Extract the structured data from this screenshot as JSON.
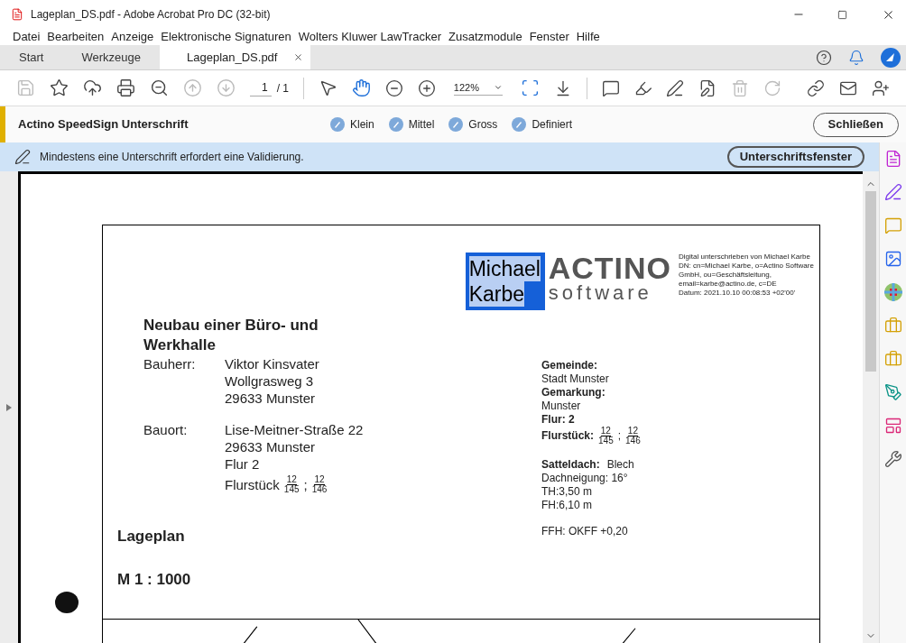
{
  "window": {
    "title": "Lageplan_DS.pdf - Adobe Acrobat Pro DC (32-bit)"
  },
  "menu": [
    "Datei",
    "Bearbeiten",
    "Anzeige",
    "Elektronische Signaturen",
    "Wolters Kluwer LawTracker",
    "Zusatzmodule",
    "Fenster",
    "Hilfe"
  ],
  "tabs": [
    {
      "label": "Start",
      "selected": false,
      "closable": false
    },
    {
      "label": "Werkzeuge",
      "selected": false,
      "closable": false
    },
    {
      "label": "Lageplan_DS.pdf",
      "selected": true,
      "closable": true
    }
  ],
  "toolbar": {
    "file_buttons": [
      {
        "disabled": true
      },
      {
        "disabled": false
      },
      {
        "disabled": false
      },
      {
        "disabled": false
      },
      {
        "disabled": false
      },
      {
        "disabled": true
      },
      {
        "disabled": true
      }
    ],
    "page": {
      "value": "1",
      "total": "/ 1"
    },
    "select_tools": [
      {
        "selected": false
      },
      {
        "selected": true
      }
    ],
    "zoom": "122%",
    "edit_buttons": [
      {
        "disabled": false
      },
      {
        "disabled": false
      },
      {
        "disabled": false
      },
      {
        "disabled": false
      },
      {
        "disabled": true
      },
      {
        "disabled": true
      },
      {
        "disabled": false
      },
      {
        "disabled": false
      },
      {
        "disabled": false
      }
    ]
  },
  "speedsign": {
    "title": "Actino SpeedSign Unterschrift",
    "sizes": [
      "Klein",
      "Mittel",
      "Gross",
      "Definiert"
    ],
    "close": "Schließen"
  },
  "notice": {
    "text": "Mindestens eine Unterschrift erfordert eine Validierung.",
    "button": "Unterschriftsfenster"
  },
  "document": {
    "signature": {
      "name": [
        "Michael",
        "Karbe"
      ],
      "logo": [
        "ACTINO",
        "software"
      ],
      "details": [
        "Digital unterschrieben von Michael Karbe",
        "DN: cn=Michael Karbe, o=Actino Software GmbH, ou=Geschäftsleitung, email=karbe@actino.de, c=DE",
        "Datum: 2021.10.10 00:08:53 +02'00'"
      ]
    },
    "heading": [
      "Neubau einer Büro- und",
      "Werkhalle"
    ],
    "parties": [
      {
        "label": "Bauherr:",
        "lines": [
          "Viktor Kinsvater",
          "Wollgrasweg 3",
          "29633 Munster"
        ]
      },
      {
        "label": "Bauort:",
        "lines": [
          "Lise-Meitner-Straße 22",
          "29633 Munster",
          "Flur 2"
        ],
        "parcel": {
          "label": "Flurstück",
          "fractions": [
            {
              "num": "12",
              "den": "145"
            },
            {
              "num": "12",
              "den": "146"
            }
          ],
          "separator": ";"
        }
      }
    ],
    "plan_title": "Lageplan",
    "scale": "M 1 : 1000",
    "details_groups": [
      [
        {
          "kind": "label",
          "text": "Gemeinde:"
        },
        {
          "kind": "text",
          "text": "Stadt Munster"
        },
        {
          "kind": "label",
          "text": "Gemarkung:"
        },
        {
          "kind": "text",
          "text": "Munster"
        },
        {
          "kind": "label",
          "text": "Flur: 2"
        },
        {
          "kind": "parcel",
          "text": "Flurstück:",
          "fractions": [
            {
              "num": "12",
              "den": "145"
            },
            {
              "num": "12",
              "den": "146"
            }
          ],
          "separator": ";"
        }
      ],
      [
        {
          "kind": "pair",
          "text": "Satteldach:",
          "value": "Blech"
        },
        {
          "kind": "text",
          "text": "Dachneigung: 16°"
        },
        {
          "kind": "text",
          "text": "TH:3,50 m"
        },
        {
          "kind": "text",
          "text": "FH:6,10 m"
        }
      ],
      [
        {
          "kind": "text",
          "text": "FFH: OKFF +0,20"
        }
      ]
    ]
  }
}
